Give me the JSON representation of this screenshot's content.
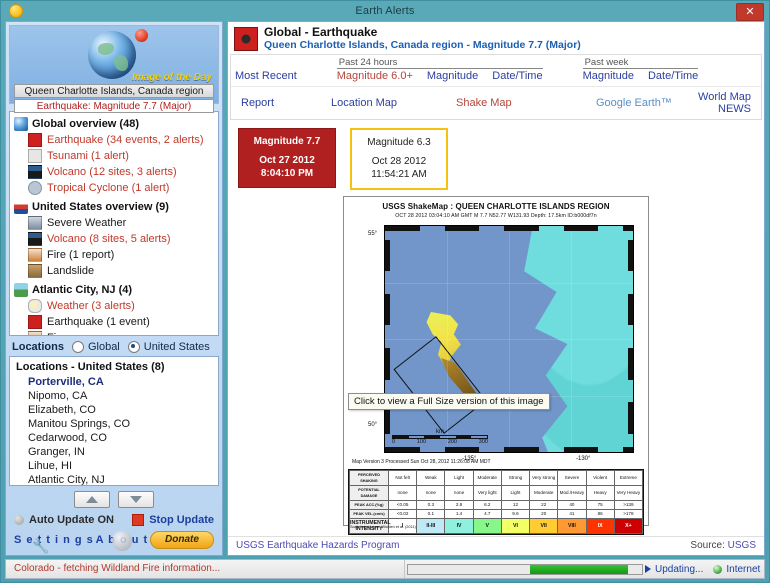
{
  "window": {
    "title": "Earth Alerts",
    "close_label": "✕",
    "sun_icon": "sun-icon"
  },
  "sidebar": {
    "image_of_the_day": {
      "label": "Image of the Day",
      "region": "Queen Charlotte Islands, Canada region",
      "event": "Earthquake: Magnitude 7.7 (Major)"
    },
    "tree": [
      {
        "icon": "globe-icon",
        "icon_class": "ic-globe",
        "label": "Global overview (48)",
        "children": [
          {
            "icon": "earthquake-icon",
            "icon_class": "ic-quake",
            "label": "Earthquake (34 events, 2 alerts)",
            "alert": true
          },
          {
            "icon": "tsunami-icon",
            "icon_class": "ic-tsu",
            "label": "Tsunami (1 alert)",
            "alert": true
          },
          {
            "icon": "volcano-icon",
            "icon_class": "ic-volc",
            "label": "Volcano (12 sites, 3 alerts)",
            "alert": true
          },
          {
            "icon": "cyclone-icon",
            "icon_class": "ic-cyc",
            "label": "Tropical Cyclone (1 alert)",
            "alert": true
          }
        ]
      },
      {
        "icon": "us-flag-icon",
        "icon_class": "ic-flag",
        "label": "United States overview (9)",
        "children": [
          {
            "icon": "severe-weather-icon",
            "icon_class": "ic-sev",
            "label": "Severe Weather",
            "alert": false
          },
          {
            "icon": "volcano-icon",
            "icon_class": "ic-volc",
            "label": "Volcano (8 sites, 5 alerts)",
            "alert": true
          },
          {
            "icon": "fire-icon",
            "icon_class": "ic-fire",
            "label": "Fire (1 report)",
            "alert": false
          },
          {
            "icon": "landslide-icon",
            "icon_class": "ic-land",
            "label": "Landslide",
            "alert": false
          }
        ]
      },
      {
        "icon": "city-icon",
        "icon_class": "ic-city",
        "label": "Atlantic City, NJ (4)",
        "children": [
          {
            "icon": "weather-icon",
            "icon_class": "ic-weather",
            "label": "Weather (3 alerts)",
            "alert": true
          },
          {
            "icon": "earthquake-icon",
            "icon_class": "ic-quake",
            "label": "Earthquake (1 event)",
            "alert": false
          },
          {
            "icon": "fire-icon",
            "icon_class": "ic-fire",
            "label": "Fire",
            "alert": false
          }
        ]
      }
    ],
    "locations_tabs": {
      "label": "Locations",
      "options": [
        {
          "label": "Global",
          "selected": false
        },
        {
          "label": "United States",
          "selected": true
        }
      ]
    },
    "locations_list": {
      "header": "Locations - United States (8)",
      "items": [
        {
          "label": "Porterville, CA",
          "selected": true
        },
        {
          "label": "Nipomo, CA",
          "selected": false
        },
        {
          "label": "Elizabeth, CO",
          "selected": false
        },
        {
          "label": "Manitou Springs, CO",
          "selected": false
        },
        {
          "label": "Cedarwood, CO",
          "selected": false
        },
        {
          "label": "Granger, IN",
          "selected": false
        },
        {
          "label": "Lihue, HI",
          "selected": false
        },
        {
          "label": "Atlantic City, NJ",
          "selected": false
        }
      ]
    },
    "nav_arrows": {
      "up": "▲",
      "down": "▼"
    },
    "auto_update": "Auto Update ON",
    "stop_update": "Stop Update",
    "settings": "S e t t i n g s",
    "about": "A b o u t",
    "donate": "Donate"
  },
  "main": {
    "badge_icon": "earthquake-icon",
    "title": "Global - Earthquake",
    "subtitle": "Queen Charlotte Islands, Canada region - Magnitude 7.7 (Major)",
    "nav_row1": {
      "most_recent": "Most Recent",
      "past24_header": "Past 24 hours",
      "past24_links": [
        "Magnitude 6.0+",
        "Magnitude",
        "Date/Time"
      ],
      "pastweek_header": "Past week",
      "pastweek_links": [
        "Magnitude",
        "Date/Time"
      ]
    },
    "nav_row2": {
      "report": "Report",
      "location_map": "Location Map",
      "shake_map": "Shake Map",
      "google_earth": "Google Earth™",
      "world_map": "World Map",
      "news": "NEWS"
    },
    "cards": [
      {
        "magnitude": "Magnitude 7.7",
        "date": "Oct 27 2012",
        "time": "8:04:10 PM",
        "selected": true
      },
      {
        "magnitude": "Magnitude 6.3",
        "date": "Oct 28 2012",
        "time": "11:54:21 AM",
        "selected": false
      }
    ],
    "tooltip": "Click to view a Full Size version of this image",
    "footer": {
      "link": "USGS Earthquake Hazards Program",
      "source_label": "Source:",
      "source_value": "USGS"
    }
  },
  "shakemap": {
    "title": "USGS ShakeMap : QUEEN CHARLOTTE ISLANDS REGION",
    "subtitle": "OCT 28 2012 03:04:10 AM GMT   M 7.7   N52.77 W131.93   Depth: 17.5km   ID:b000df7n",
    "lat_labels": [
      "55°",
      "50°"
    ],
    "lon_labels": [
      "-135°",
      "-130°"
    ],
    "scale_unit": "km",
    "scale_ticks": [
      "0",
      "100",
      "200",
      "300"
    ],
    "map_version": "Map Version 3 Processed Sun Oct 28, 2012 11:26:08 AM MDT",
    "legend_note": "Scale based upon Worden et al. (2011)",
    "legend": {
      "rows": [
        {
          "label": "PERCEIVED SHAKING",
          "cells": [
            "Not felt",
            "Weak",
            "Light",
            "Moderate",
            "Strong",
            "Very strong",
            "Severe",
            "Violent",
            "Extreme"
          ]
        },
        {
          "label": "POTENTIAL DAMAGE",
          "cells": [
            "none",
            "none",
            "none",
            "Very light",
            "Light",
            "Moderate",
            "Mod./Heavy",
            "Heavy",
            "Very Heavy"
          ]
        },
        {
          "label": "PEAK ACC.(%g)",
          "cells": [
            "<0.05",
            "0.3",
            "2.8",
            "6.2",
            "12",
            "22",
            "40",
            "75",
            ">139"
          ]
        },
        {
          "label": "PEAK VEL.(cm/s)",
          "cells": [
            "<0.02",
            "0.1",
            "1.4",
            "4.7",
            "9.6",
            "20",
            "41",
            "86",
            ">178"
          ]
        },
        {
          "label": "INSTRUMENTAL INTENSITY",
          "cells": [
            "I",
            "II-III",
            "IV",
            "V",
            "VI",
            "VII",
            "VIII",
            "IX",
            "X+"
          ]
        }
      ],
      "intensity_colors": [
        "#ffffff",
        "#bfe9f5",
        "#8ff0e0",
        "#87f78a",
        "#f2ff66",
        "#ffcc33",
        "#ff9933",
        "#ff3300",
        "#cc0000"
      ]
    }
  },
  "status": {
    "message": "Colorado - fetching Wildland Fire information...",
    "progress_percent": 42,
    "updating": "Updating...",
    "internet": "Internet"
  }
}
